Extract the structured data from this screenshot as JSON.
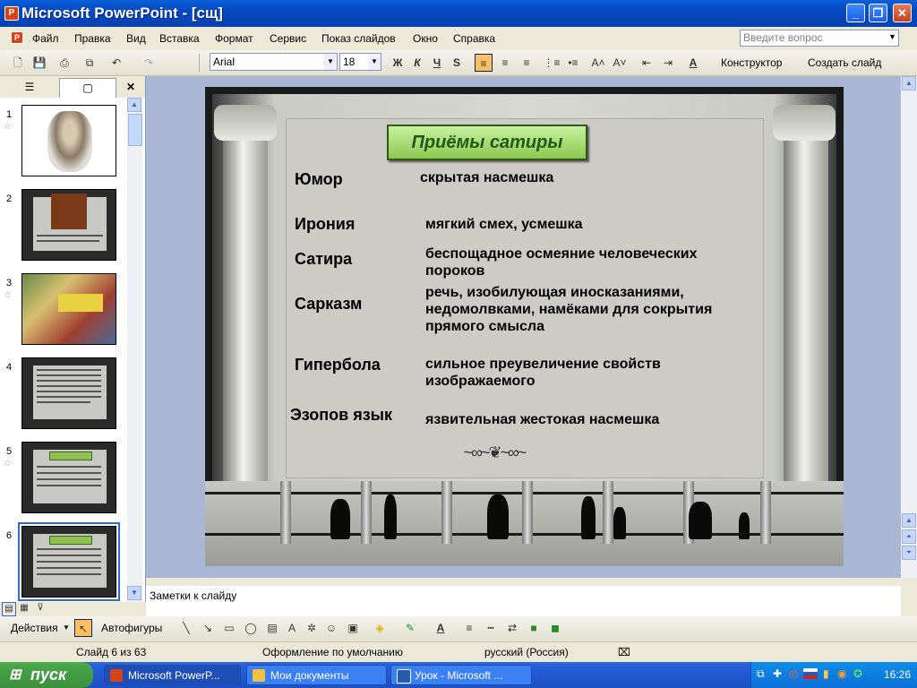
{
  "window": {
    "title": "Microsoft PowerPoint - [сщ]"
  },
  "menu": [
    "Файл",
    "Правка",
    "Вид",
    "Вставка",
    "Формат",
    "Сервис",
    "Показ слайдов",
    "Окно",
    "Справка"
  ],
  "help": {
    "placeholder": "Введите вопрос"
  },
  "toolbar": {
    "font": "Arial",
    "size": "18",
    "bold": "Ж",
    "italic": "К",
    "underline": "Ч",
    "shadow": "S",
    "designer": "Конструктор",
    "new_slide": "Создать слайд"
  },
  "slides_panel": {
    "slide_numbers": [
      "1",
      "2",
      "3",
      "4",
      "5",
      "6"
    ],
    "selected": "6"
  },
  "slide": {
    "heading": "Приёмы сатиры",
    "terms": [
      {
        "term": "Юмор",
        "definition": "скрытая насмешка"
      },
      {
        "term": "Ирония",
        "definition": "мягкий смех, усмешка"
      },
      {
        "term": "Сатира",
        "definition": "беспощадное осмеяние человеческих пороков"
      },
      {
        "term": "Сарказм",
        "definition": "речь, изобилующая иносказаниями, недомолвками, намёками для сокрытия прямого смысла"
      },
      {
        "term": "Гипербола",
        "definition": "сильное преувеличение свойств изображаемого"
      },
      {
        "term": "Эзопов язык",
        "definition": "язвительная жестокая насмешка"
      }
    ]
  },
  "notes": {
    "placeholder": "Заметки к слайду"
  },
  "drawbar": {
    "actions": "Действия",
    "autoshapes": "Автофигуры"
  },
  "status": {
    "slide": "Слайд 6 из 63",
    "design": "Оформление по умолчанию",
    "language": "русский (Россия)"
  },
  "taskbar": {
    "start": "пуск",
    "tasks": [
      "Microsoft PowerP...",
      "Мои документы",
      "Урок - Microsoft ..."
    ],
    "clock": "16:26"
  }
}
